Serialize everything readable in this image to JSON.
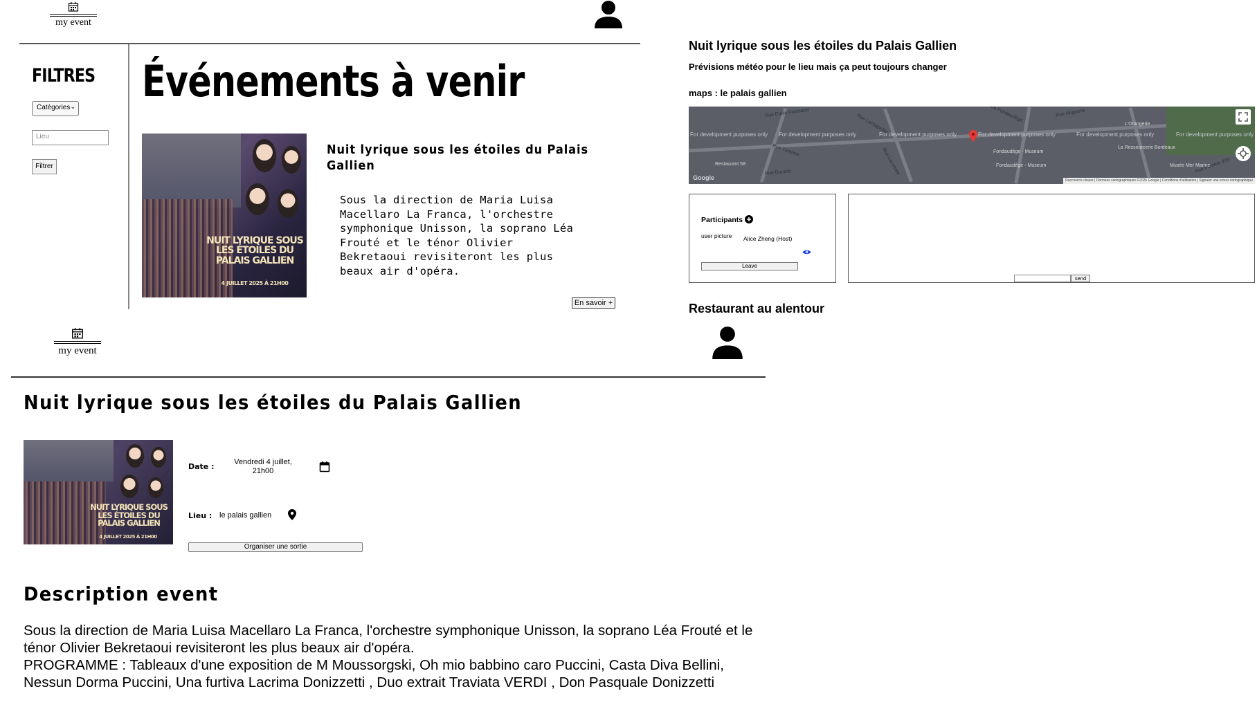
{
  "brand": {
    "logo_text": "my event"
  },
  "list_page": {
    "filters_title": "FILTRES",
    "category_select": "Catégories",
    "lieu_placeholder": "Lieu",
    "filter_button": "Filtrer",
    "heading": "Événements à venir",
    "event_card": {
      "title": "Nuit lyrique sous les étoiles du Palais Gallien",
      "description": "Sous la direction de Maria Luisa Macellaro La Franca, l'orchestre symphonique Unisson, la soprano Léa Frouté et le ténor Olivier Bekretaoui revisiteront les plus beaux air d'opéra.",
      "more_button": "En savoir +"
    }
  },
  "poster": {
    "title_lines": [
      "NUIT LYRIQUE SOUS",
      "LES ÉTOILES DU",
      "PALAIS GALLIEN"
    ],
    "date": "4 JUILLET 2025 À 21H00"
  },
  "detail_page": {
    "title": "Nuit lyrique sous les étoiles du Palais Gallien",
    "date_label": "Date :",
    "date_value": "Vendredi 4 juillet, 21h00",
    "lieu_label": "Lieu :",
    "lieu_value": "le palais gallien",
    "organize_button": "Organiser une sortie",
    "description_heading": "Description event",
    "description_text": "Sous la direction de Maria Luisa Macellaro La Franca, l'orchestre symphonique Unisson, la soprano Léa Frouté et le ténor Olivier Bekretaoui revisiteront les plus beaux air d'opéra.",
    "programme_text": "PROGRAMME : Tableaux d'une exposition de M Moussorgski, Oh mio babbino caro Puccini, Casta Diva Bellini, Nessun Dorma Puccini, Una furtiva Lacrima Donizzetti , Duo extrait Traviata VERDI , Don Pasquale Donizzetti"
  },
  "sortie_page": {
    "title": "Nuit lyrique sous les étoiles du Palais Gallien",
    "weather_text": "Prévisions météo pour le lieu mais ça peut toujours changer",
    "maps_label": "maps : le palais gallien",
    "map": {
      "dev_watermark": "For development purposes only",
      "streets": [
        "Rue Emile Fourcand",
        "Rue Turenne",
        "Rue Lechapelier",
        "Rue Durand",
        "Rue Huguerie",
        "Rue Lacornée",
        "Rue Fondaudège",
        "Rue Pomme d'Or"
      ],
      "places": [
        "Fondaudège - Museum",
        "Fondaudège - Museum",
        "Restaurant 58",
        "L'Orangerie",
        "La Ressourcerie Bordeaux",
        "Musée Mer Marine"
      ],
      "logo": "Google",
      "footer": "Raccourcis clavier | Données cartographiques ©2025 Google | Conditions d'utilisation | Signaler une erreur cartographique"
    },
    "participants": {
      "title": "Participants",
      "image_alt": "user picture",
      "member": "Alice Zheng (Host)",
      "leave_button": "Leave"
    },
    "chat": {
      "send_button": "send"
    },
    "restaurants_heading": "Restaurant au alentour"
  },
  "colors": {
    "map_bg": "#5b5e66",
    "marker": "#e53935",
    "eye": "#1a3fd6"
  },
  "icons": [
    "calendar-icon",
    "user-icon",
    "pin-icon",
    "plus-circle-icon",
    "eye-icon",
    "fullscreen-icon",
    "locate-icon"
  ]
}
